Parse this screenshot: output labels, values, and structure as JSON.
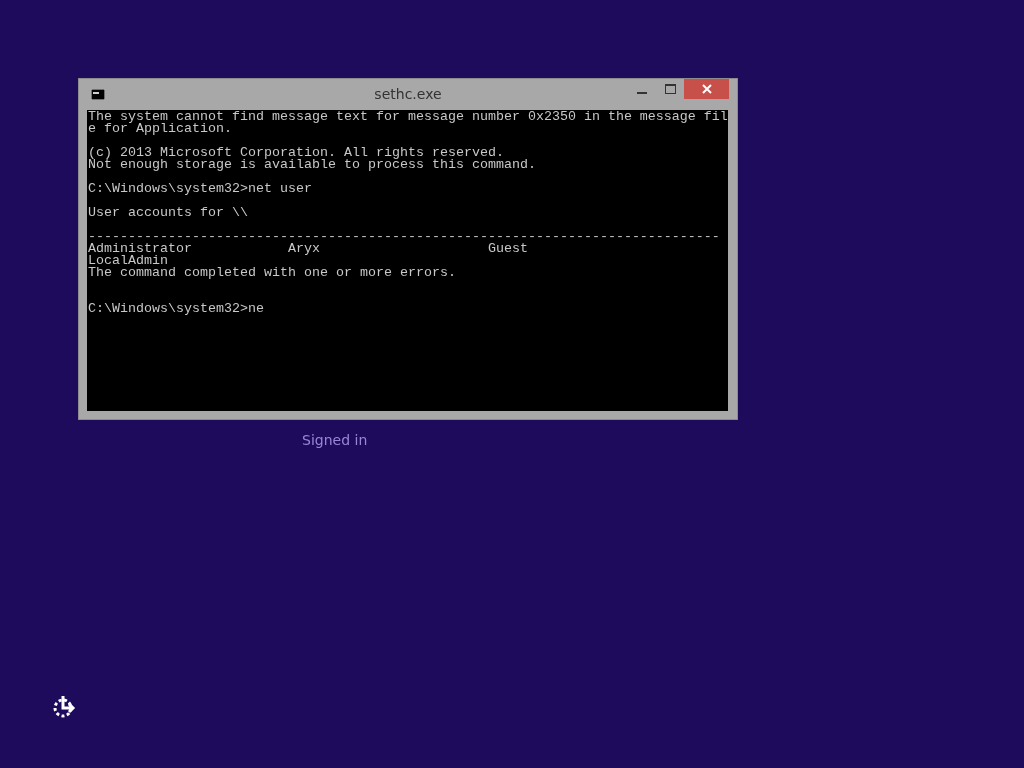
{
  "window": {
    "title": "sethc.exe",
    "console_text": "The system cannot find message text for message number 0x2350 in the message fil\ne for Application.\n\n(c) 2013 Microsoft Corporation. All rights reserved.\nNot enough storage is available to process this command.\n\nC:\\Windows\\system32>net user\n\nUser accounts for \\\\\n\n-------------------------------------------------------------------------------\nAdministrator            Aryx                     Guest\nLocalAdmin\nThe command completed with one or more errors.\n\n\nC:\\Windows\\system32>ne"
  },
  "lock_screen": {
    "status": "Signed in"
  }
}
